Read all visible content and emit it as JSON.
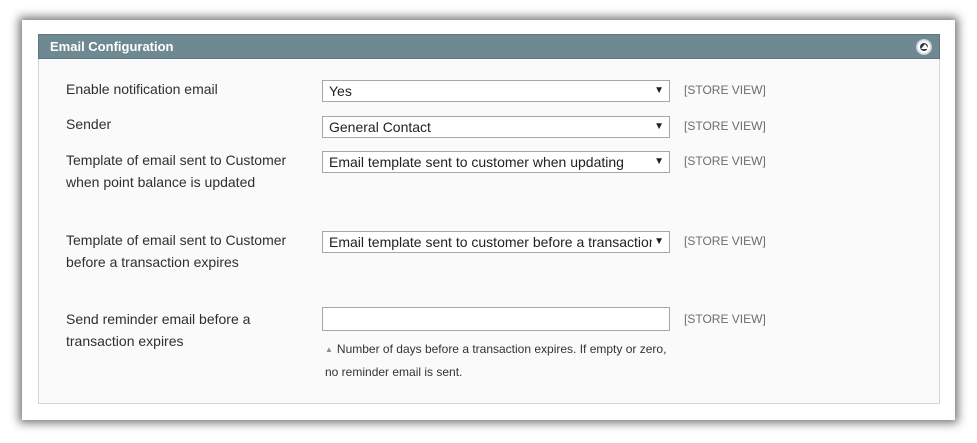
{
  "section": {
    "title": "Email Configuration",
    "collapse_icon": "collapse-up-icon"
  },
  "rows": [
    {
      "label": "Enable notification email",
      "value": "Yes",
      "scope": "[STORE VIEW]"
    },
    {
      "label": "Sender",
      "value": "General Contact",
      "scope": "[STORE VIEW]"
    },
    {
      "label": "Template of email sent to Customer when point balance is updated",
      "value": "Email template sent to customer when updating",
      "scope": "[STORE VIEW]"
    },
    {
      "label": "Template of email sent to Customer before a transaction expires",
      "value": "Email template sent to customer before a transaction",
      "scope": "[STORE VIEW]"
    },
    {
      "label": "Send reminder email before a transaction expires",
      "value": "",
      "scope": "[STORE VIEW]",
      "note": "Number of days before a transaction expires. If empty or zero, no reminder email is sent."
    }
  ],
  "dropdown_arrow": "▼",
  "note_icon": "▲",
  "colors": {
    "header_bg": "#6f8992",
    "body_bg": "#fafafa",
    "scope_text": "#6d6d6d"
  }
}
